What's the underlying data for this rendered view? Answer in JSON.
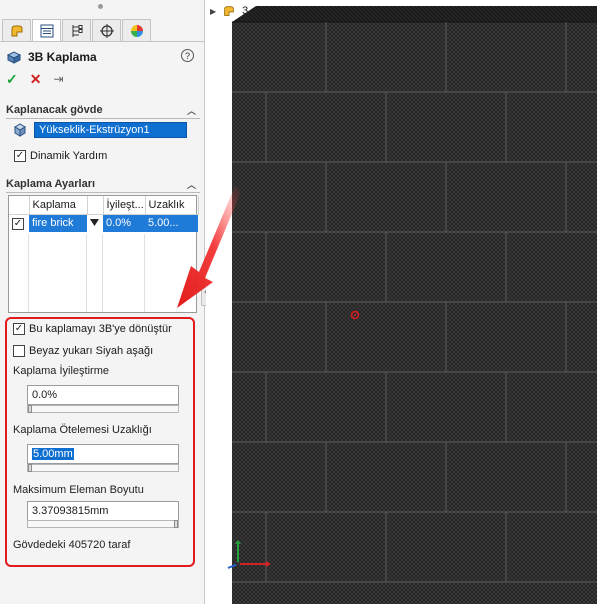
{
  "panel": {
    "tabs": [
      {
        "icon": "feature-manager-icon"
      },
      {
        "icon": "property-manager-icon"
      },
      {
        "icon": "configuration-manager-icon"
      },
      {
        "icon": "dimxpert-icon"
      },
      {
        "icon": "display-manager-icon"
      }
    ],
    "title": "3B Kaplama",
    "help_icon": "?",
    "actions": {
      "ok": "✓",
      "cancel": "✕",
      "pin": "⇥"
    }
  },
  "section_body": {
    "header": "Kaplanacak gövde",
    "selected_body": "Yükseklik-Ekstrüzyon1",
    "dynamic_help_label": "Dinamik Yardım",
    "dynamic_help_checked": true
  },
  "section_settings": {
    "header": "Kaplama Ayarları",
    "table": {
      "columns": [
        "Kaplama",
        "İyileşt...",
        "Uzaklık"
      ],
      "rows": [
        {
          "checked": true,
          "texture": "fire brick",
          "refinement": "0.0%",
          "distance": "5.00..."
        }
      ]
    }
  },
  "group": {
    "convert_label": "Bu kaplamayı 3B'ye dönüştür",
    "convert_checked": true,
    "white_up_label": "Beyaz yukarı Siyah aşağı",
    "white_up_checked": false,
    "refinement_label": "Kaplama İyileştirme",
    "refinement_value": "0.0%",
    "refinement_slider": 0.0,
    "offset_label": "Kaplama Ötelemesi Uzaklığı",
    "offset_value": "5.00mm",
    "offset_slider": 0.0,
    "max_element_label": "Maksimum Eleman Boyutu",
    "max_element_value": "3.37093815mm",
    "max_element_slider": 1.0,
    "face_count": "Gövdedeki 405720 taraf"
  },
  "viewport": {
    "tree_fragment": "3",
    "colors": {
      "mesh_dark": "#2b2b2b",
      "highlight": "#e11b1b",
      "accent": "#0e6fd0"
    }
  }
}
